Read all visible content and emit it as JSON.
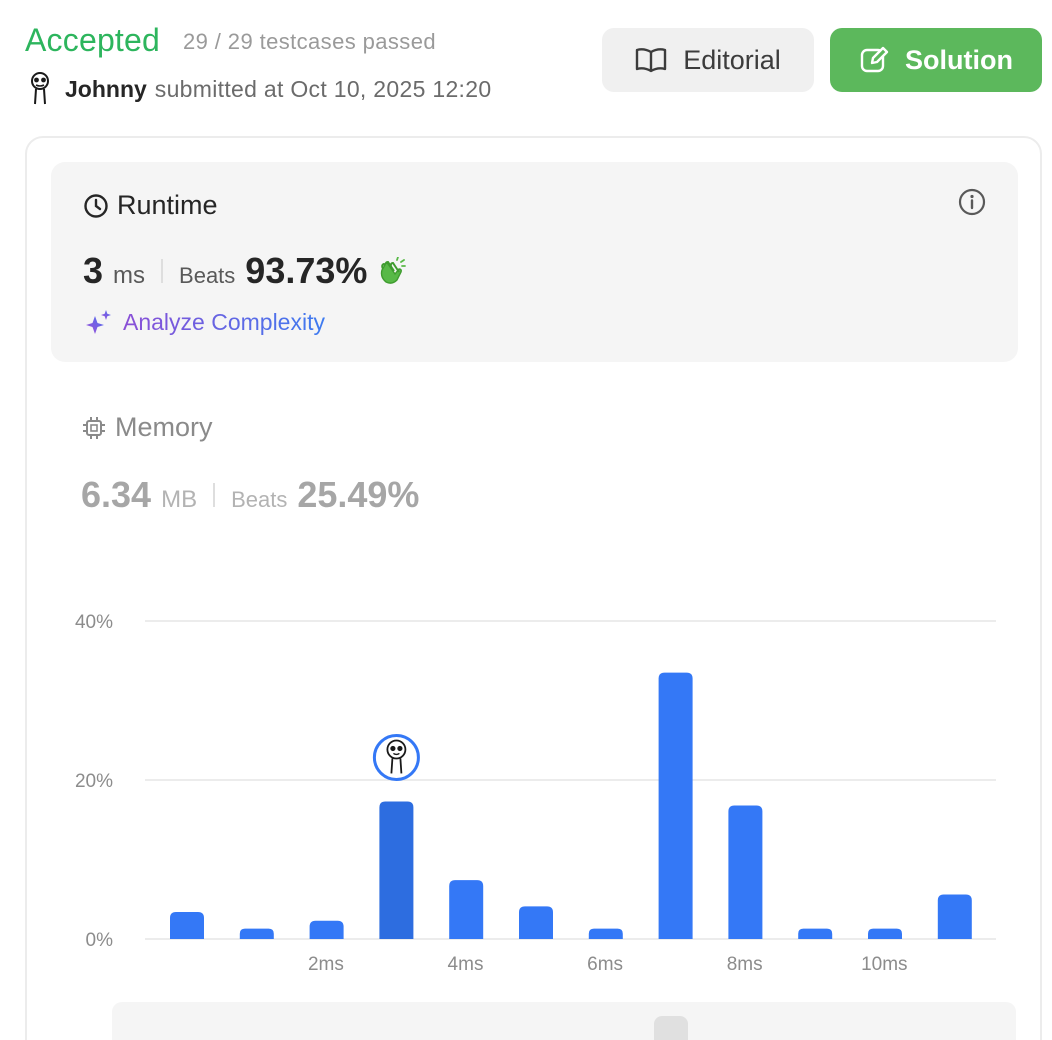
{
  "submission": {
    "status": "Accepted",
    "testcases": "29 / 29 testcases passed",
    "username": "Johnny",
    "submitted_text": "submitted at Oct 10, 2025 12:20"
  },
  "buttons": {
    "editorial": "Editorial",
    "solution": "Solution"
  },
  "runtime": {
    "title": "Runtime",
    "value": "3",
    "unit": "ms",
    "beats_label": "Beats",
    "beats": "93.73%",
    "analyze": "Analyze Complexity"
  },
  "memory": {
    "title": "Memory",
    "value": "6.34",
    "unit": "MB",
    "beats_label": "Beats",
    "beats": "25.49%"
  },
  "colors": {
    "accepted": "#2db55d",
    "solution_button": "#5cb85c",
    "bar": "#3478f6",
    "bar_selected": "#2d6de0"
  },
  "icons": {
    "editorial": "book-open-icon",
    "solution": "edit-icon",
    "runtime": "clock-icon",
    "memory": "chip-icon",
    "info": "info-icon",
    "analyze": "sparkles-icon",
    "beats": "clapping-hands-icon"
  },
  "chart_data": {
    "type": "bar",
    "x_ticks": [
      2,
      4,
      6,
      8,
      10
    ],
    "x_tick_labels": [
      "2ms",
      "4ms",
      "6ms",
      "8ms",
      "10ms"
    ],
    "x": [
      0,
      1,
      2,
      3,
      4,
      5,
      6,
      7,
      8,
      9,
      10,
      11
    ],
    "values": [
      3.4,
      1.3,
      2.3,
      17.3,
      7.4,
      4.1,
      1.3,
      33.5,
      16.8,
      1.3,
      1.3,
      5.6
    ],
    "y_ticks": [
      0,
      20,
      40
    ],
    "y_tick_labels": [
      "0%",
      "20%",
      "40%"
    ],
    "ylim": [
      0,
      40
    ],
    "selected_x": 3,
    "grid": true
  }
}
